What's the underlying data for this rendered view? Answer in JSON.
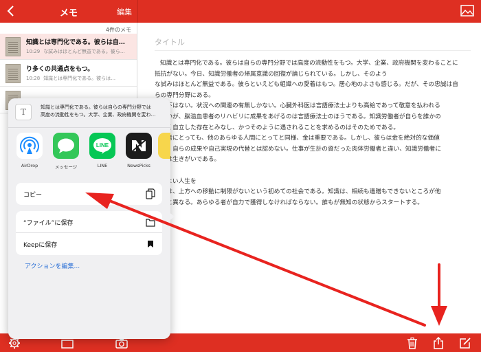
{
  "header": {
    "title": "メモ",
    "edit_label": "編集"
  },
  "sidebar": {
    "count_label": "4件のメモ",
    "items": [
      {
        "title": "知識とは専門化である。彼らは自…",
        "time": "10:29",
        "snippet": "な試みはほとんど無益である。彼ら…"
      },
      {
        "title": "り多くの共通点をもつ。",
        "time": "10:28",
        "snippet": "知識とは専門化である。彼らは…"
      },
      {
        "title": "",
        "time": "",
        "snippet": ""
      }
    ]
  },
  "editor": {
    "title_placeholder": "タイトル",
    "lines": [
      "知識とは専門化である。彼らは自らの専門分野では高度の流動性をもつ。大学、企業、政府機関を変わることに",
      "抵抗がない。今日、知識労働者の帰属意識の回復が論じられている。しかし、そのよう",
      "な試みはほとんど無益である。彼らといえども組織への愛着はもつ。居心地のよさも感じる。だが、その忠誠は自",
      "らの専門分野にある。",
      "に上下はない。状況への関連の有無しかない。心臓外科医は言語療法士よりも高給であって敬意を払われる",
      "れないが、脳溢血患者のリハビリに成果をあげるのは言語療法士のほうである。知識労働者が自らを誰かの",
      "はなく自立した存在とみなし、かつそのように遇されることを求めるのはそのためである。",
      "労働者にとっても、他のあらゆる人間にとってと同様、金は重要である。しかし、彼らは金を絶対的な価値",
      "ない。自らの成果や自己実現の代替とは認めない。仕事が生計の資だった肉体労働者と違い、知識労働者に",
      "仕事は生きがいである。",
      "",
      "よりよい人生を",
      "社会は、上方への移動に制限がないという初めての社会である。知識は、相続も遺贈もできないところが他",
      "手段と異なる。あらゆる者が自力で獲得しなければならない。誰もが無知の状態からスタートする。"
    ]
  },
  "share_sheet": {
    "preview_lines": [
      "知識とは専門化である。彼らは自らの専門分野では",
      "高度の流動性をもつ。大学、企業、政府機関を変わ…"
    ],
    "preview_icon_glyph": "T",
    "apps": [
      {
        "label": "AirDrop",
        "icon": "airdrop-icon",
        "color": "#ffffff"
      },
      {
        "label": "メッセージ",
        "icon": "messages-icon",
        "color": "#34c759"
      },
      {
        "label": "LINE",
        "icon": "line-icon",
        "color": "#06c755"
      },
      {
        "label": "NewsPicks",
        "icon": "newspicks-icon",
        "color": "#1c1c1c"
      }
    ],
    "copy_label": "コピー",
    "save_to_files_label": "“ファイル”に保存",
    "save_to_keep_label": "Keepに保存",
    "edit_actions_label": "アクションを編集..."
  },
  "colors": {
    "accent_red": "#de2f22",
    "link_blue": "#2a6fd6",
    "annotation_red": "#e8231f"
  }
}
